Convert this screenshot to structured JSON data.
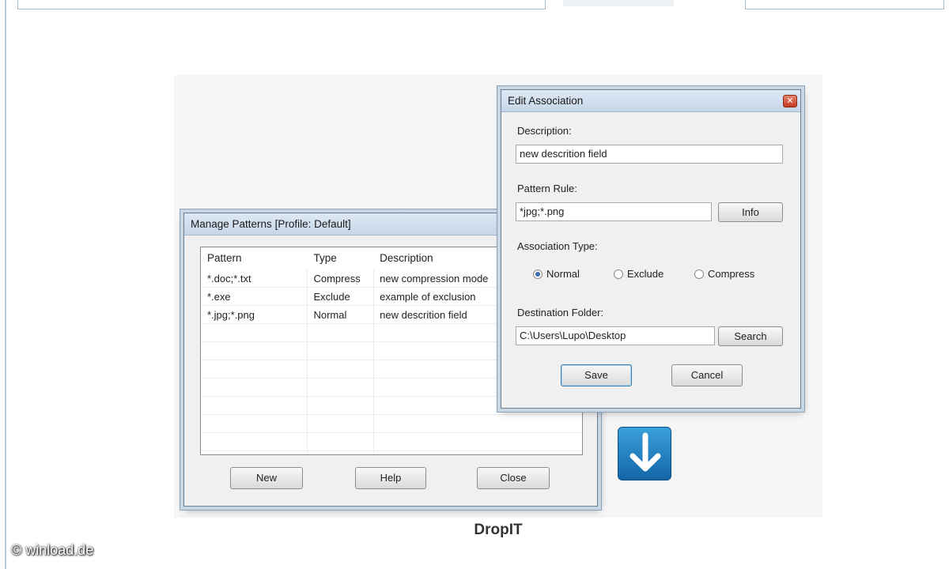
{
  "manage_window": {
    "title": "Manage Patterns [Profile: Default]",
    "columns": [
      "Pattern",
      "Type",
      "Description"
    ],
    "rows": [
      {
        "pattern": "*.doc;*.txt",
        "type": "Compress",
        "description": "new compression mode"
      },
      {
        "pattern": "*.exe",
        "type": "Exclude",
        "description": "example of exclusion"
      },
      {
        "pattern": "*.jpg;*.png",
        "type": "Normal",
        "description": "new descrition field"
      }
    ],
    "buttons": {
      "new": "New",
      "help": "Help",
      "close": "Close"
    }
  },
  "edit_window": {
    "title": "Edit Association",
    "close_glyph": "✕",
    "description_label": "Description:",
    "description_value": "new descrition field",
    "pattern_label": "Pattern Rule:",
    "pattern_value": "*jpg;*.png",
    "info_button": "Info",
    "assoc_label": "Association Type:",
    "assoc_options": [
      "Normal",
      "Exclude",
      "Compress"
    ],
    "assoc_selected": "Normal",
    "dest_label": "Destination Folder:",
    "dest_value": "C:\\Users\\Lupo\\Desktop",
    "search_button": "Search",
    "save_button": "Save",
    "cancel_button": "Cancel"
  },
  "caption": "DropIT",
  "watermark": "© winload.de",
  "colors": {
    "accent": "#1b7bc4",
    "titlebar": "#c6d6e9"
  }
}
